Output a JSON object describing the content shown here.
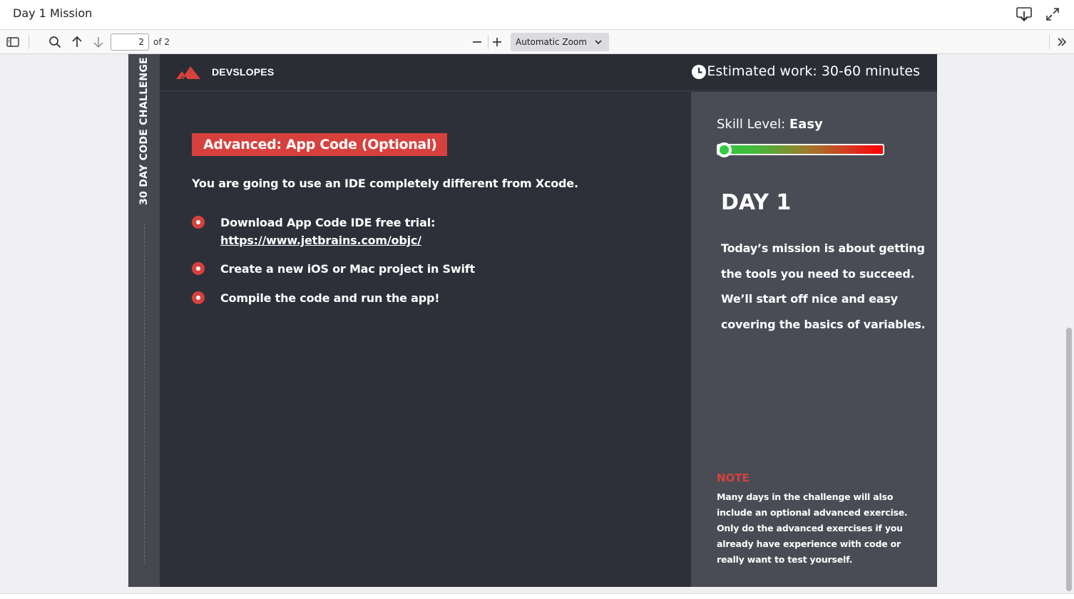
{
  "window": {
    "title": "Day 1 Mission",
    "download_icon": "download-icon",
    "fullscreen_icon": "expand-icon"
  },
  "toolbar": {
    "sidebar_icon": "sidebar-toggle-icon",
    "search_icon": "search-icon",
    "prev_icon": "arrow-up-icon",
    "next_icon": "arrow-down-icon",
    "page_number": "2",
    "page_total": "of 2",
    "zoom_out_icon": "minus-icon",
    "zoom_in_icon": "plus-icon",
    "zoom_value": "Automatic Zoom",
    "tools_icon": "double-chevron-right-icon"
  },
  "page": {
    "side_label": "30 DAY CODE CHALLENGE",
    "brand": "DEVSLOPES",
    "estimate": "Estimated work: 30-60 minutes",
    "badge": "Advanced: App Code (Optional)",
    "intro": "You are going to use an IDE completely different from Xcode.",
    "bullets": [
      {
        "text": "Download App Code IDE free trial:",
        "link": "https://www.jetbrains.com/objc/"
      },
      {
        "text": "Create a new iOS or Mac project in Swift"
      },
      {
        "text": "Compile the code and run the app!"
      }
    ],
    "skill_label": "Skill Level: ",
    "skill_value": "Easy",
    "skill_level_fraction": 0.0,
    "day_title": "DAY 1",
    "day_description": "Today’s mission is about getting the tools you need to succeed. We’ll start off nice and easy covering the basics of variables.",
    "note_title": "NOTE",
    "note_body": "Many days in the challenge will also include an optional advanced exercise. Only do the advanced exercises if you already have experience with code or really want to test yourself.",
    "colors": {
      "accent_red": "#d7413d",
      "page_bg": "#2e3039",
      "panel_bg": "#4a4c55"
    }
  }
}
